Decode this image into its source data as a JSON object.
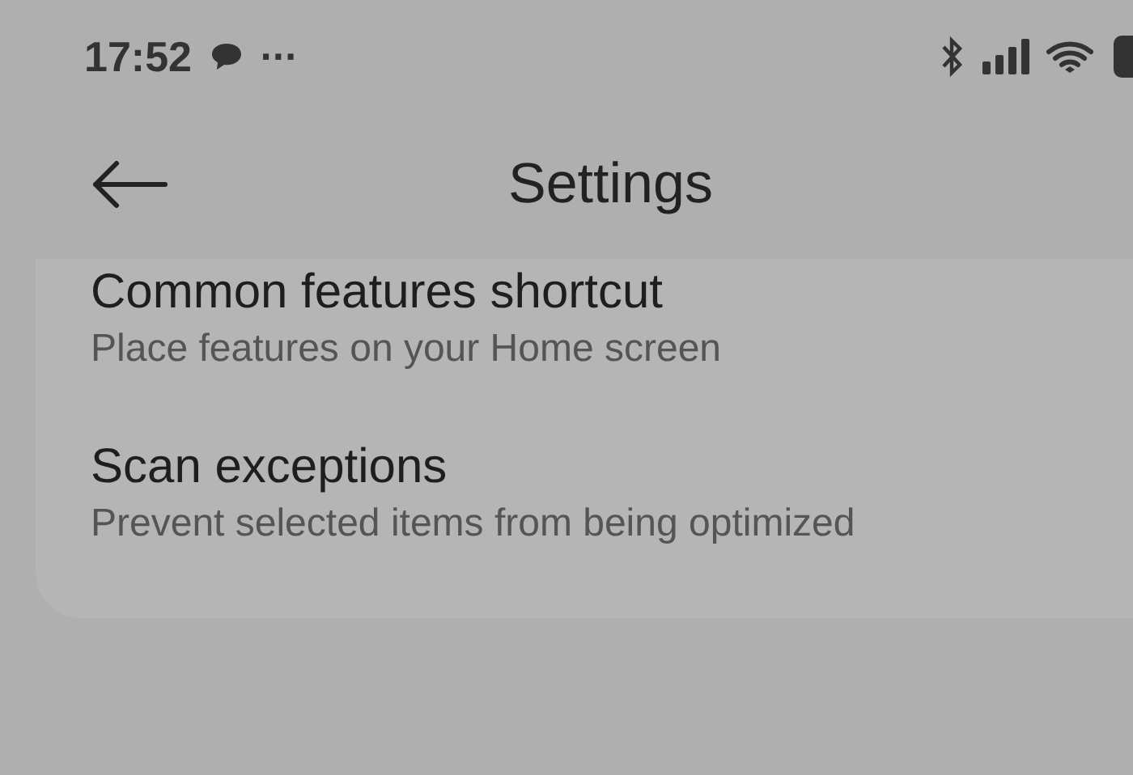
{
  "status_bar": {
    "time": "17:52",
    "notification_more": "···"
  },
  "header": {
    "title": "Settings"
  },
  "items": [
    {
      "title": "Common features shortcut",
      "subtitle": "Place features on your Home screen"
    },
    {
      "title": "Scan exceptions",
      "subtitle": "Prevent selected items from being optimized"
    }
  ]
}
